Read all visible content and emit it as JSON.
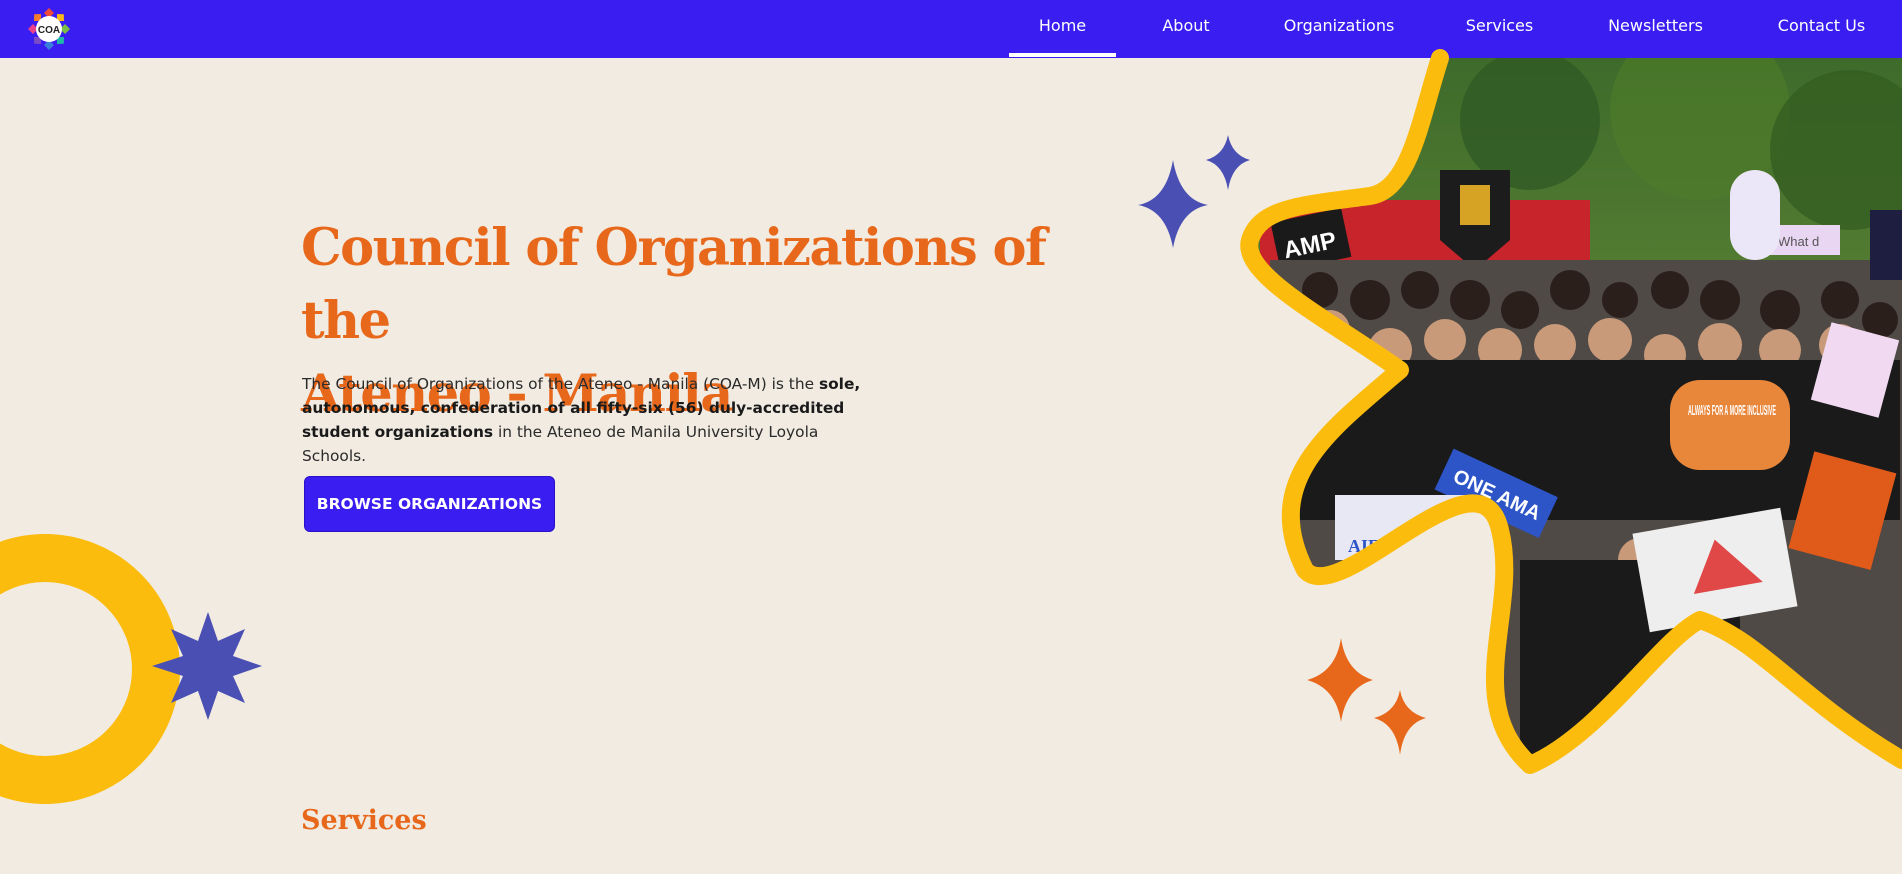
{
  "brand": {
    "logo_text": "COA"
  },
  "nav": {
    "items": [
      {
        "label": "Home",
        "active": true
      },
      {
        "label": "About"
      },
      {
        "label": "Organizations"
      },
      {
        "label": "Services"
      },
      {
        "label": "Newsletters"
      },
      {
        "label": "Contact Us"
      }
    ]
  },
  "hero": {
    "title_line1": "Council of Organizations of the",
    "title_line2": "Ateneo - Manila",
    "description_parts": [
      "The Council of Organizations of the Ateneo - Manila (COA-M) is the ",
      "sole, autonomous, confederation of all fifty-six (56) duly-accredited student organizations",
      " in the Ateneo de Manila University Loyola Schools."
    ],
    "cta_label": "BROWSE ORGANIZATIONS",
    "photo_sign_texts": [
      "AMP",
      "ONE AMA",
      "AIESEC",
      "ALWAYS FOR A MORE INCLUSIVE",
      "What d"
    ]
  },
  "services": {
    "heading": "Services"
  },
  "colors": {
    "nav_bg": "#3a1df0",
    "page_bg": "#f1ebe2",
    "accent_orange": "#e8681b",
    "accent_yellow": "#fcbc0d",
    "star_blue": "#4a4fb3"
  },
  "icons": [
    "coa-logo-icon",
    "four-point-star-icon",
    "eight-point-star-icon",
    "ring-decoration"
  ]
}
